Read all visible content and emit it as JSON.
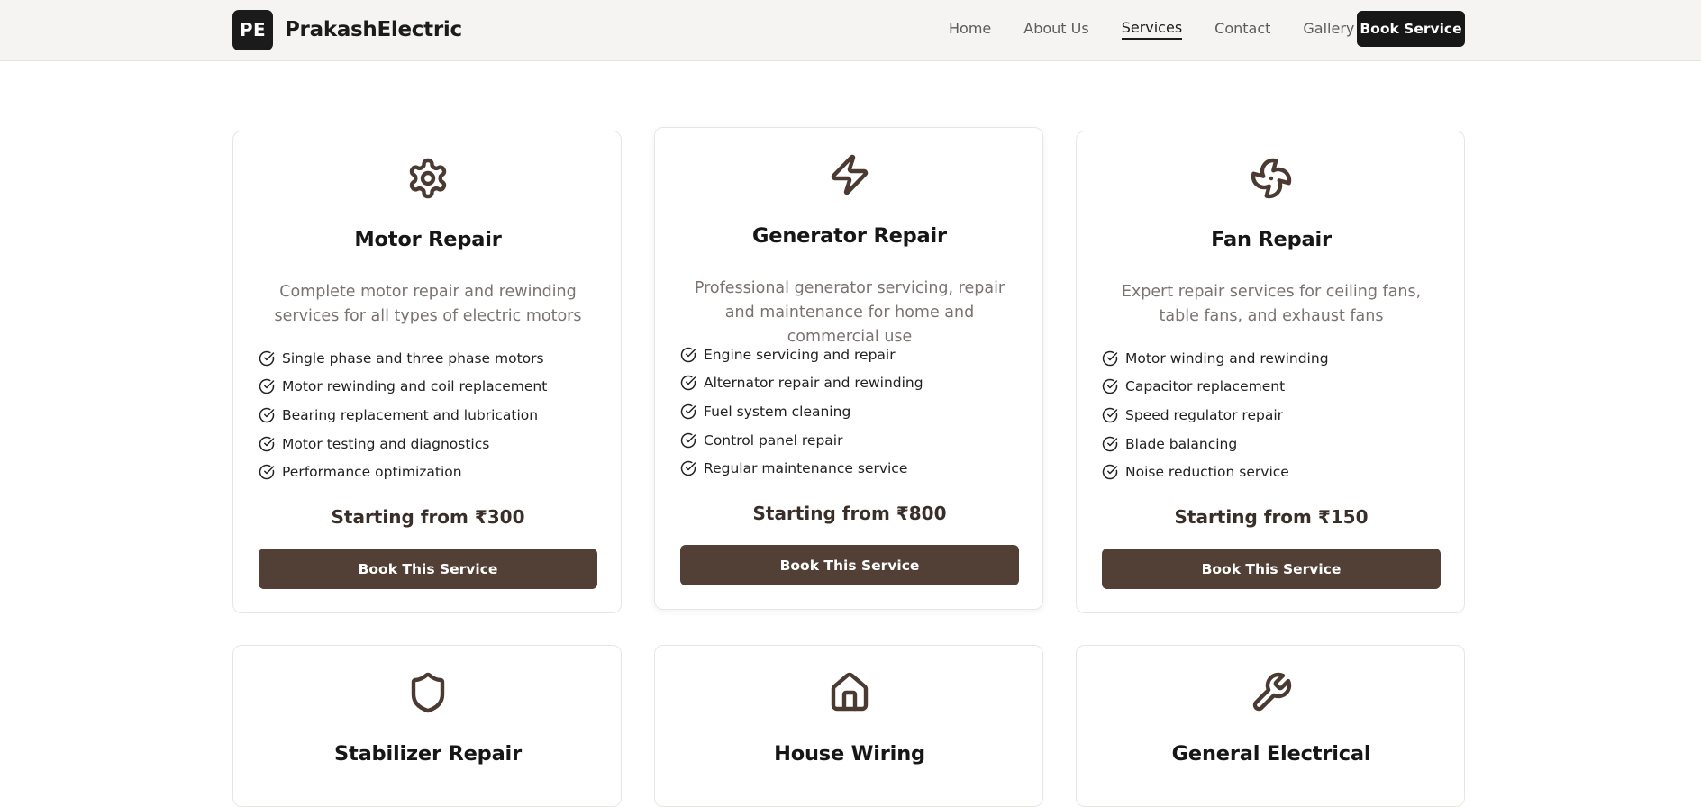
{
  "header": {
    "logo_text": "PE",
    "brand_name": "PrakashElectric",
    "nav": [
      {
        "label": "Home",
        "active": false
      },
      {
        "label": "About Us",
        "active": false
      },
      {
        "label": "Services",
        "active": true
      },
      {
        "label": "Contact",
        "active": false
      },
      {
        "label": "Gallery",
        "active": false
      }
    ],
    "cta_label": "Book Service"
  },
  "services": [
    {
      "icon": "gear-icon",
      "title": "Motor Repair",
      "description": "Complete motor repair and rewinding services for all types of electric motors",
      "features": [
        "Single phase and three phase motors",
        "Motor rewinding and coil replacement",
        "Bearing replacement and lubrication",
        "Motor testing and diagnostics",
        "Performance optimization"
      ],
      "price": "Starting from ₹300",
      "button": "Book This Service"
    },
    {
      "icon": "lightning-icon",
      "title": "Generator Repair",
      "description": "Professional generator servicing, repair and maintenance for home and commercial use",
      "features": [
        "Engine servicing and repair",
        "Alternator repair and rewinding",
        "Fuel system cleaning",
        "Control panel repair",
        "Regular maintenance service"
      ],
      "price": "Starting from ₹800",
      "button": "Book This Service"
    },
    {
      "icon": "fan-icon",
      "title": "Fan Repair",
      "description": "Expert repair services for ceiling fans, table fans, and exhaust fans",
      "features": [
        "Motor winding and rewinding",
        "Capacitor replacement",
        "Speed regulator repair",
        "Blade balancing",
        "Noise reduction service"
      ],
      "price": "Starting from ₹150",
      "button": "Book This Service"
    },
    {
      "icon": "shield-icon",
      "title": "Stabilizer Repair"
    },
    {
      "icon": "house-icon",
      "title": "House Wiring"
    },
    {
      "icon": "wrench-icon",
      "title": "General Electrical"
    }
  ],
  "colors": {
    "accent": "#523f35",
    "icon": "#4b3a31",
    "header_bg": "#f5f4f2",
    "cta_bg": "#171717"
  }
}
